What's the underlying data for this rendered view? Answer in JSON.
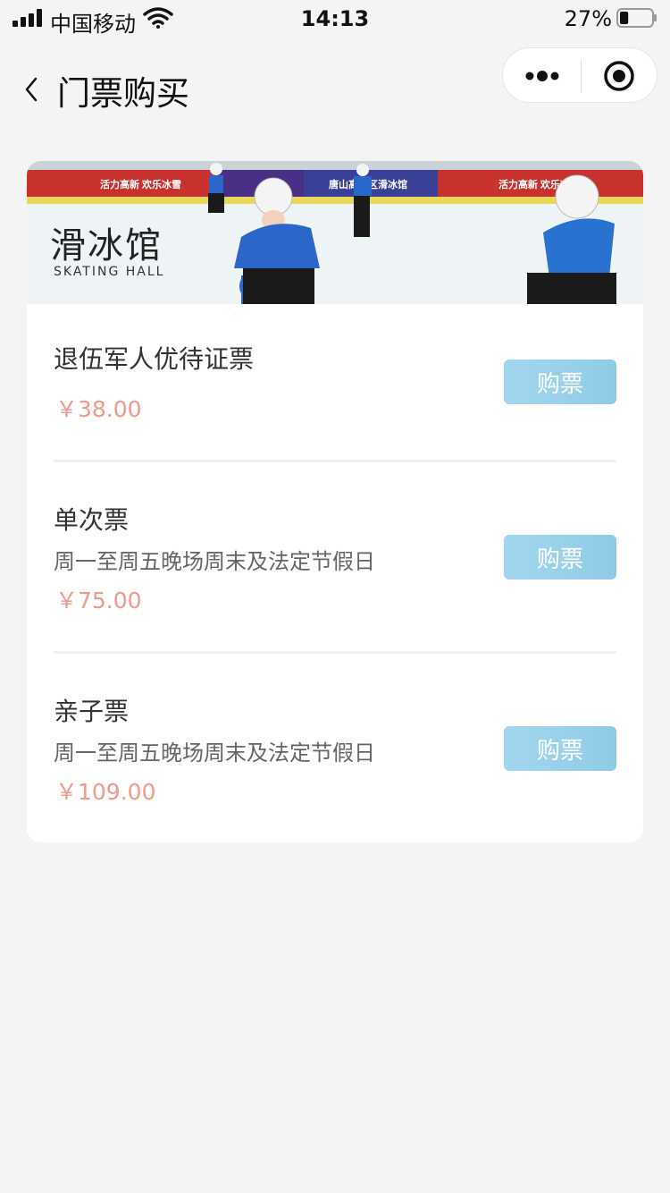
{
  "status_bar": {
    "carrier": "中国移动",
    "time": "14:13",
    "battery": "27%",
    "battery_level": 0.27
  },
  "nav": {
    "title": "门票购买",
    "back_icon": "chevron-left-icon",
    "more_icon": "more-dots-icon",
    "close_icon": "target-circle-icon"
  },
  "banner": {
    "title": "滑冰馆",
    "subtitle": "SKATING HALL",
    "board_text_1": "活力高新 欢乐冰雪",
    "board_text_2": "唐山高新区滑冰馆",
    "board_text_3": "活力高新 欢乐冰雪"
  },
  "tickets": [
    {
      "name": "退伍军人优待证票",
      "desc": "",
      "price": "￥38.00",
      "button": "购票"
    },
    {
      "name": "单次票",
      "desc": "周一至周五晚场周末及法定节假日",
      "price": "￥75.00",
      "button": "购票"
    },
    {
      "name": "亲子票",
      "desc": "周一至周五晚场周末及法定节假日",
      "price": "￥109.00",
      "button": "购票"
    }
  ],
  "colors": {
    "price": "#ee9a8e",
    "button": "#9dd2ec",
    "background": "#f4f4f4"
  }
}
